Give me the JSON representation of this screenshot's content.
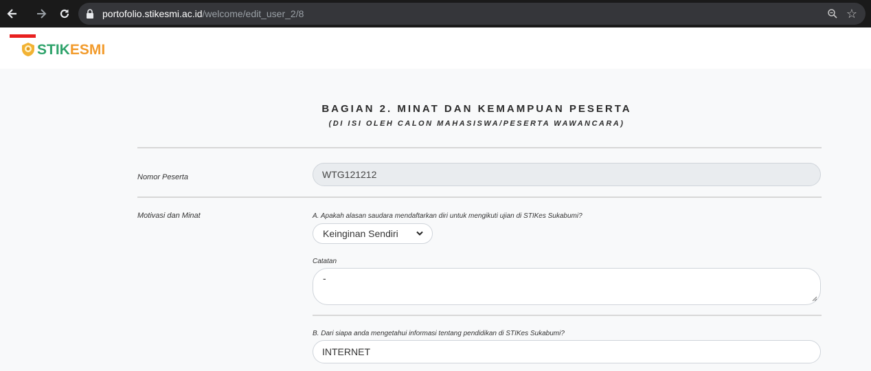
{
  "browser": {
    "host": "portofolio.stikesmi.ac.id",
    "path": "/welcome/edit_user_2/8",
    "icons": [
      "back-icon",
      "forward-icon",
      "reload-icon",
      "lock-icon",
      "zoom-icon",
      "star-icon"
    ]
  },
  "header": {
    "logo_part1": "STIK",
    "logo_part2": "ESMI",
    "brand_colors": {
      "green": "#2fa36b",
      "orange": "#f29b2c",
      "red": "#e8201f"
    }
  },
  "section": {
    "title": "BAGIAN 2. MINAT DAN KEMAMPUAN PESERTA",
    "subtitle": "(DI ISI OLEH CALON MAHASISWA/PESERTA WAWANCARA)"
  },
  "form": {
    "nomor_label": "Nomor Peserta",
    "nomor_value": "WTG121212",
    "motivasi_label": "Motivasi dan Minat",
    "question_a": "A. Apakah alasan saudara mendaftarkan diri untuk mengikuti ujian di STIKes Sukabumi?",
    "question_a_selected": "Keinginan Sendiri",
    "catatan_label": "Catatan",
    "catatan_value": "-",
    "question_b": "B. Dari siapa anda mengetahui informasi tentang pendidikan di STIKes Sukabumi?",
    "question_b_value": "INTERNET"
  }
}
